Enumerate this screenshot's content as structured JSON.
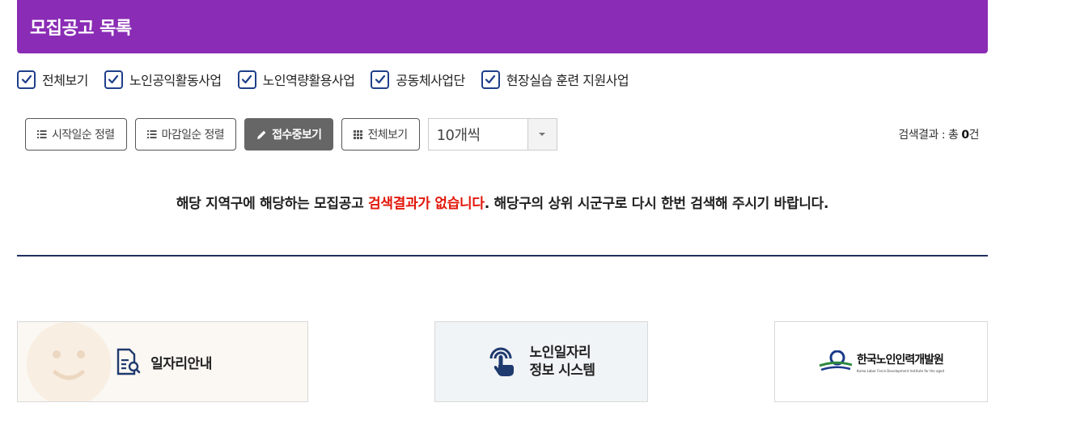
{
  "header": {
    "title": "모집공고 목록"
  },
  "filters": [
    {
      "label": "전체보기",
      "checked": true
    },
    {
      "label": "노인공익활동사업",
      "checked": true
    },
    {
      "label": "노인역량활용사업",
      "checked": true
    },
    {
      "label": "공동체사업단",
      "checked": true
    },
    {
      "label": "현장실습 훈련 지원사업",
      "checked": true
    }
  ],
  "toolbar": {
    "sort_start": "시작일순 정렬",
    "sort_end": "마감일순 정렬",
    "receiving": "접수중보기",
    "view_all": "전체보기",
    "page_size": "10개씩"
  },
  "result": {
    "prefix": "검색결과 : 총 ",
    "count": "0",
    "suffix": "건"
  },
  "message": {
    "part1": "해당 지역구에 해당하는 모집공고 ",
    "highlight": "검색결과가 없습니다",
    "part2": ". 해당구의 상위 시군구로 다시 한번 검색해 주시기 바랍니다."
  },
  "banners": {
    "job_guide": "일자리안내",
    "system_line1": "노인일자리",
    "system_line2": "정보 시스템",
    "institute_name": "한국노인인력개발원",
    "institute_en": "Korea Labor Force Development Institute for the aged"
  },
  "colors": {
    "header_bg": "#8a2cb5",
    "checkbox": "#1f3f8a",
    "highlight": "#e3170a",
    "divider": "#1f2f5f"
  }
}
